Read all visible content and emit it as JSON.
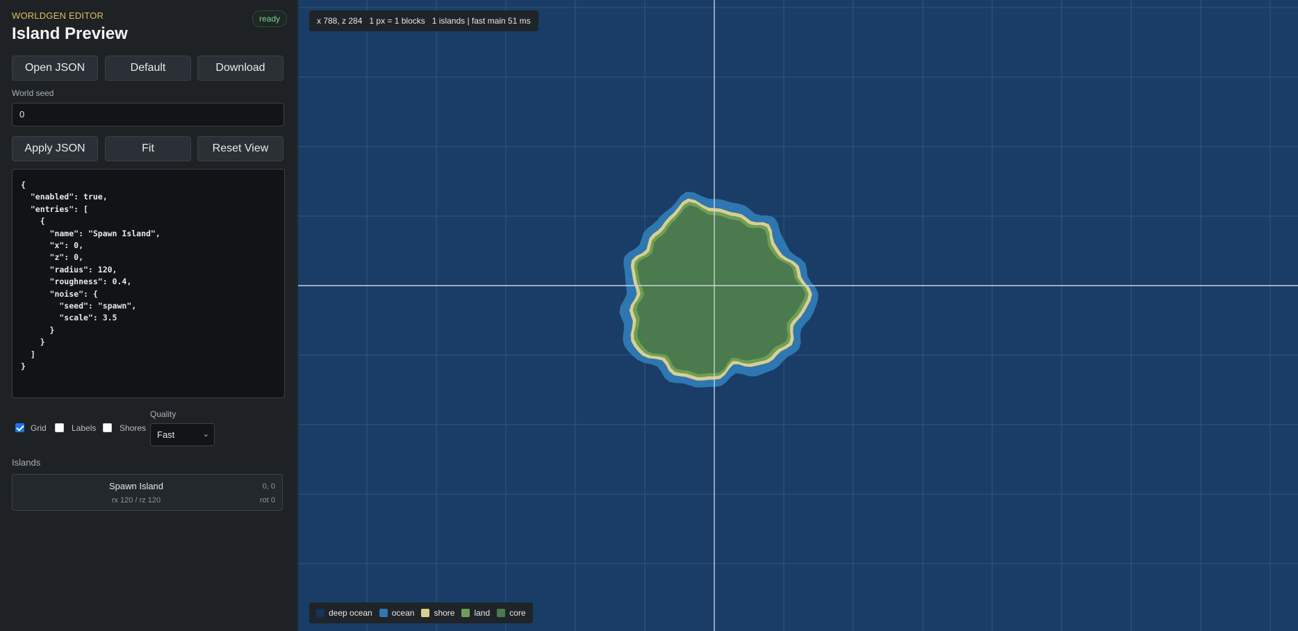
{
  "app": {
    "label": "WORLDGEN EDITOR",
    "status": "ready",
    "title": "Island Preview"
  },
  "toolbar": {
    "open_json": "Open JSON",
    "default": "Default",
    "download": "Download",
    "apply_json": "Apply JSON",
    "fit": "Fit",
    "reset_view": "Reset View"
  },
  "seed": {
    "label": "World seed",
    "value": "0"
  },
  "json_text": "{\n  \"enabled\": true,\n  \"entries\": [\n    {\n      \"name\": \"Spawn Island\",\n      \"x\": 0,\n      \"z\": 0,\n      \"radius\": 120,\n      \"roughness\": 0.4,\n      \"noise\": {\n        \"seed\": \"spawn\",\n        \"scale\": 3.5\n      }\n    }\n  ]\n}",
  "options": {
    "grid": {
      "label": "Grid",
      "checked": true
    },
    "labels": {
      "label": "Labels",
      "checked": false
    },
    "shores": {
      "label": "Shores",
      "checked": false
    },
    "quality": {
      "label": "Quality",
      "value": "Fast"
    }
  },
  "islands": {
    "title": "Islands",
    "items": [
      {
        "name": "Spawn Island",
        "position": "0, 0",
        "dims": "rx 120 / rz 120",
        "rotation": "rot 0"
      }
    ]
  },
  "hud": {
    "text": "x 788, z 284   1 px = 1 blocks   1 islands | fast main 51 ms"
  },
  "legend": [
    {
      "label": "deep ocean",
      "color": "#13345a"
    },
    {
      "label": "ocean",
      "color": "#2f77b0"
    },
    {
      "label": "shore",
      "color": "#d9cf92"
    },
    {
      "label": "land",
      "color": "#6f9e55"
    },
    {
      "label": "core",
      "color": "#4a7a4d"
    }
  ],
  "colors": {
    "deep_ocean": "#193d66",
    "ocean": "#2f77b0",
    "shore": "#d9cf92",
    "land": "#6f9e55",
    "core": "#4a7a4d",
    "grid": "#2f5680",
    "axis": "#c9d3de",
    "accent": "#e2bd62",
    "status": "#7ccf96"
  }
}
